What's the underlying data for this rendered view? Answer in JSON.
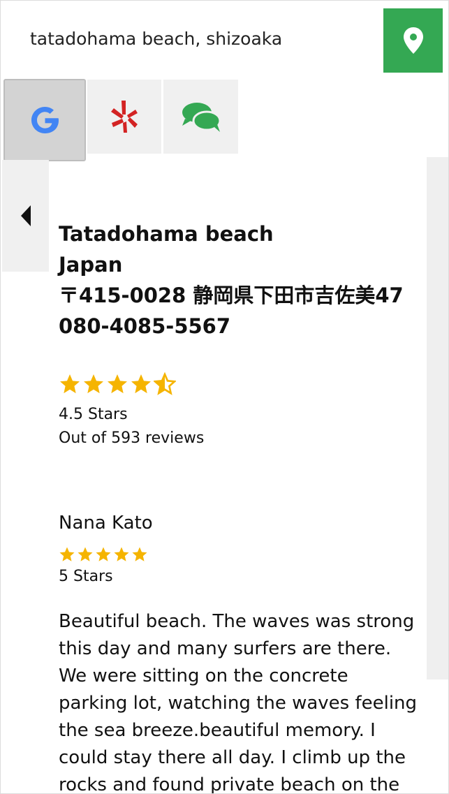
{
  "search": {
    "value": "tatadohama beach, shizoaka"
  },
  "tabs": [
    {
      "name": "google",
      "selected": true
    },
    {
      "name": "yelp",
      "selected": false
    },
    {
      "name": "chat",
      "selected": false
    }
  ],
  "place": {
    "title": "Tatadohama beach",
    "country": "Japan",
    "address": "〒415-0028 静岡県下田市吉佐美47",
    "phone": "080-4085-5567",
    "rating_value": 4.5,
    "rating_text": "4.5 Stars",
    "reviews_text": "Out of 593 reviews"
  },
  "review": {
    "author": "Nana Kato",
    "rating_value": 5,
    "rating_text": "5 Stars",
    "body": "Beautiful beach. The waves was strong this day and many surfers are there. We were sitting on the concrete parking lot, watching the waves feeling the sea breeze.beautiful memory. I could stay there all day. I climb up the rocks and found private beach on the right but then later I"
  },
  "colors": {
    "accent_green": "#34a853",
    "star_gold": "#f5b400",
    "google_blue": "#4285f4",
    "yelp_red": "#d32323"
  },
  "icons": {
    "locate": "map-pin-icon",
    "google": "google-g-icon",
    "yelp": "yelp-burst-icon",
    "chat": "chat-bubbles-icon",
    "prev": "caret-left-icon"
  }
}
